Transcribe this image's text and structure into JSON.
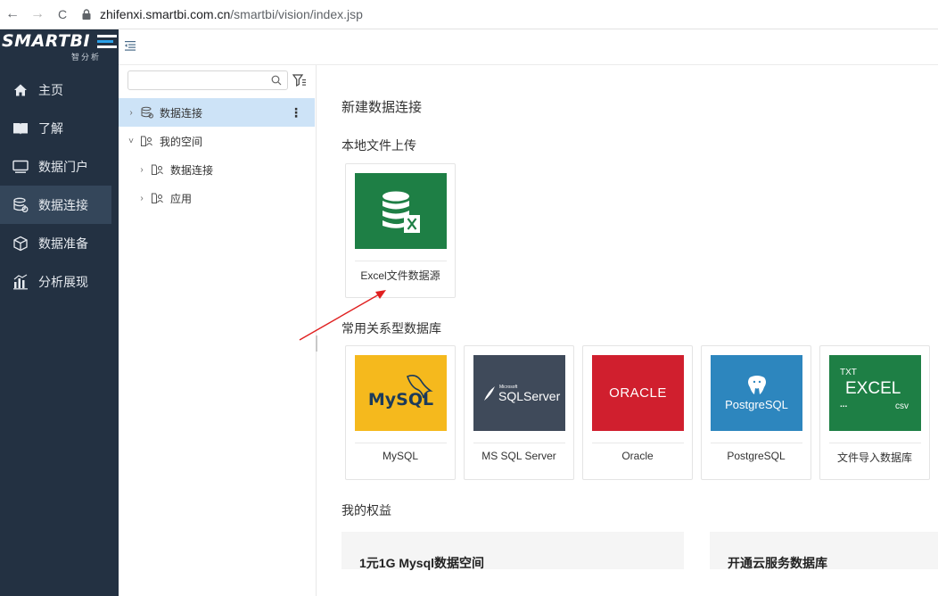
{
  "browser": {
    "back_glyph": "←",
    "forward_glyph": "→",
    "reload_glyph": "C",
    "url_host": "zhifenxi.smartbi.com.cn",
    "url_path": "/smartbi/vision/index.jsp"
  },
  "logo": {
    "text": "SMARTBI",
    "subtitle": "智分析"
  },
  "sidebar": {
    "items": [
      {
        "label": "主页",
        "icon": "home-icon"
      },
      {
        "label": "了解",
        "icon": "book-icon"
      },
      {
        "label": "数据门户",
        "icon": "monitor-icon"
      },
      {
        "label": "数据连接",
        "icon": "database-link-icon",
        "active": true
      },
      {
        "label": "数据准备",
        "icon": "cube-icon"
      },
      {
        "label": "分析展现",
        "icon": "bar-chart-icon"
      }
    ]
  },
  "tree_panel": {
    "search": {
      "value": "",
      "placeholder": ""
    },
    "items": [
      {
        "label": "数据连接",
        "level": 0,
        "expanded": false,
        "selected": true
      },
      {
        "label": "我的空间",
        "level": 0,
        "expanded": true
      },
      {
        "label": "数据连接",
        "level": 1,
        "expanded": false
      },
      {
        "label": "应用",
        "level": 1,
        "expanded": false
      }
    ]
  },
  "main": {
    "title": "新建数据连接",
    "local_upload": {
      "label": "本地文件上传",
      "cards": [
        {
          "caption": "Excel文件数据源",
          "tile_color": "#1e7f45"
        }
      ]
    },
    "relational": {
      "label": "常用关系型数据库",
      "cards": [
        {
          "caption": "MySQL",
          "tile_color": "#f5b91d",
          "tile_text": "MySQL"
        },
        {
          "caption": "MS SQL Server",
          "tile_color": "#3f4a5a",
          "tile_text": "SQLServer",
          "tile_small": "Microsoft"
        },
        {
          "caption": "Oracle",
          "tile_color": "#d01f2e",
          "tile_text": "ORACLE"
        },
        {
          "caption": "PostgreSQL",
          "tile_color": "#2d86be",
          "tile_text": "PostgreSQL"
        },
        {
          "caption": "文件导入数据库",
          "tile_color": "#1e7f45",
          "tile_text": "EXCEL",
          "tile_top": "TXT",
          "tile_dots": "...",
          "tile_csv": "csv"
        }
      ]
    },
    "benefits": {
      "label": "我的权益",
      "cards": [
        {
          "title": "1元1G Mysql数据空间"
        },
        {
          "title": "开通云服务数据库"
        }
      ]
    }
  },
  "colors": {
    "sidebar_bg": "#233142",
    "sidebar_active": "#34465a",
    "tree_selected": "#cde3f7",
    "annotation_arrow": "#e02020"
  }
}
